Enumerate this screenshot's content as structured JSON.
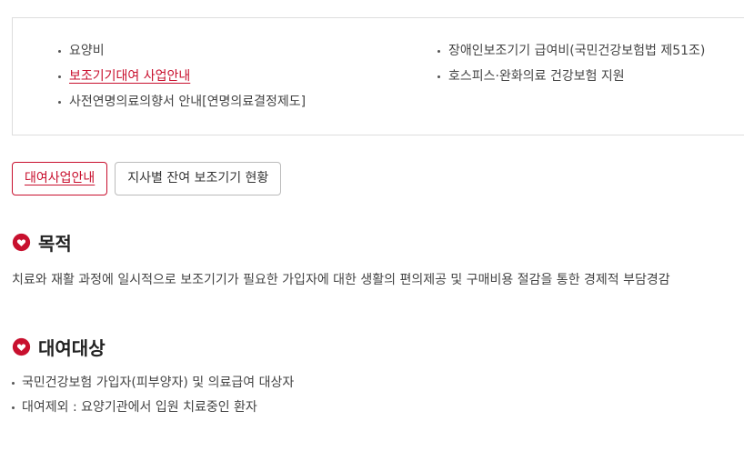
{
  "quick_links": {
    "left": [
      {
        "label": "요양비",
        "active": false
      },
      {
        "label": "보조기기대여 사업안내",
        "active": true
      },
      {
        "label": "사전연명의료의향서 안내[연명의료결정제도]",
        "active": false
      }
    ],
    "right": [
      {
        "label": "장애인보조기기 급여비(국민건강보험법 제51조)",
        "active": false
      },
      {
        "label": "호스피스·완화의료 건강보험 지원",
        "active": false
      }
    ]
  },
  "tabs": [
    {
      "label": "대여사업안내",
      "active": true
    },
    {
      "label": "지사별 잔여 보조기기 현황",
      "active": false
    }
  ],
  "sections": {
    "purpose": {
      "title": "목적",
      "icon": "heart-icon",
      "text": "치료와 재활 과정에 일시적으로 보조기기가 필요한 가입자에 대한 생활의 편의제공 및 구매비용 절감을 통한 경제적 부담경감"
    },
    "target": {
      "title": "대여대상",
      "icon": "heart-icon",
      "items": [
        "국민건강보험 가입자(피부양자) 및 의료급여 대상자",
        "대여제외 : 요양기관에서 입원 치료중인 환자"
      ]
    }
  },
  "colors": {
    "accent": "#c8102e",
    "border": "#dddddd",
    "text": "#444444"
  }
}
